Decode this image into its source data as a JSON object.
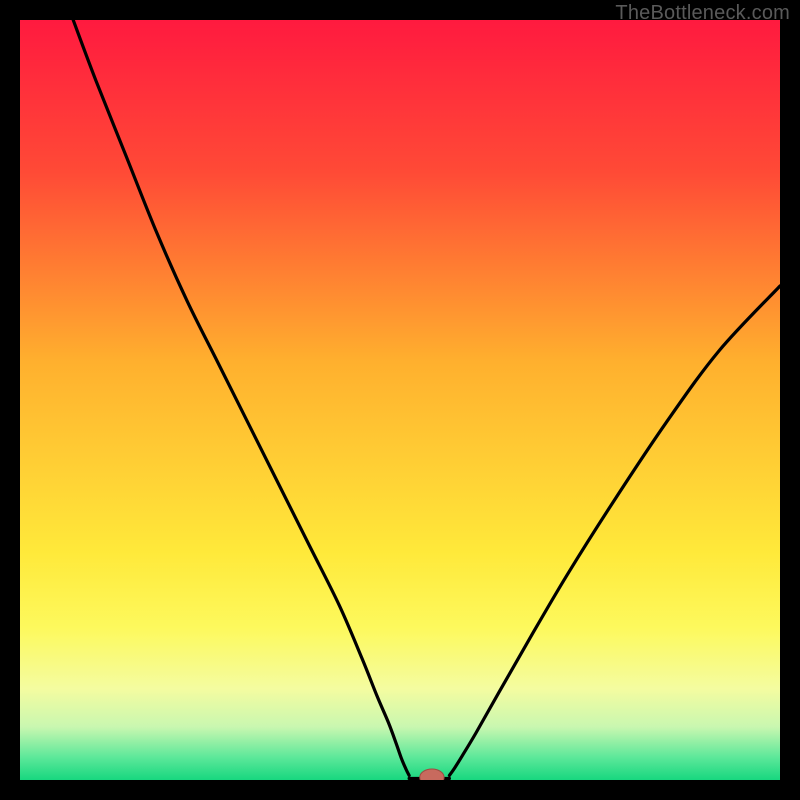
{
  "attribution": "TheBottleneck.com",
  "colors": {
    "frame": "#000000",
    "gradient_stops": [
      {
        "offset": 0.0,
        "color": "#ff1a3f"
      },
      {
        "offset": 0.2,
        "color": "#ff4a36"
      },
      {
        "offset": 0.45,
        "color": "#ffb02e"
      },
      {
        "offset": 0.7,
        "color": "#ffe93a"
      },
      {
        "offset": 0.8,
        "color": "#fdf95d"
      },
      {
        "offset": 0.88,
        "color": "#f4fca0"
      },
      {
        "offset": 0.93,
        "color": "#c9f7b0"
      },
      {
        "offset": 0.97,
        "color": "#5de89a"
      },
      {
        "offset": 1.0,
        "color": "#17d77f"
      }
    ],
    "curve": "#000000",
    "marker_fill": "#c86a5e",
    "marker_stroke": "#9e4c42"
  },
  "chart_data": {
    "type": "line",
    "title": "",
    "xlabel": "",
    "ylabel": "",
    "xlim": [
      0,
      100
    ],
    "ylim": [
      0,
      100
    ],
    "series": [
      {
        "name": "left-branch",
        "x": [
          7,
          10,
          14,
          18,
          22,
          26,
          30,
          34,
          38,
          42,
          45,
          47,
          48.5,
          49.5,
          50.2,
          50.8,
          51.2
        ],
        "values": [
          100,
          92,
          82,
          72,
          63,
          55,
          47,
          39,
          31,
          23,
          16,
          11,
          7.5,
          4.8,
          2.8,
          1.4,
          0.6
        ]
      },
      {
        "name": "right-branch",
        "x": [
          56.5,
          57.2,
          58.2,
          60,
          63,
          67,
          72,
          78,
          85,
          92,
          100
        ],
        "values": [
          0.6,
          1.6,
          3.2,
          6.2,
          11.5,
          18.5,
          27,
          36.5,
          47,
          56.5,
          65
        ]
      },
      {
        "name": "floor",
        "x": [
          51.2,
          56.5
        ],
        "values": [
          0.2,
          0.2
        ]
      }
    ],
    "marker": {
      "x": 54.2,
      "y": 0.35,
      "rx": 1.6,
      "ry": 1.1
    },
    "grid": false,
    "legend": false
  }
}
